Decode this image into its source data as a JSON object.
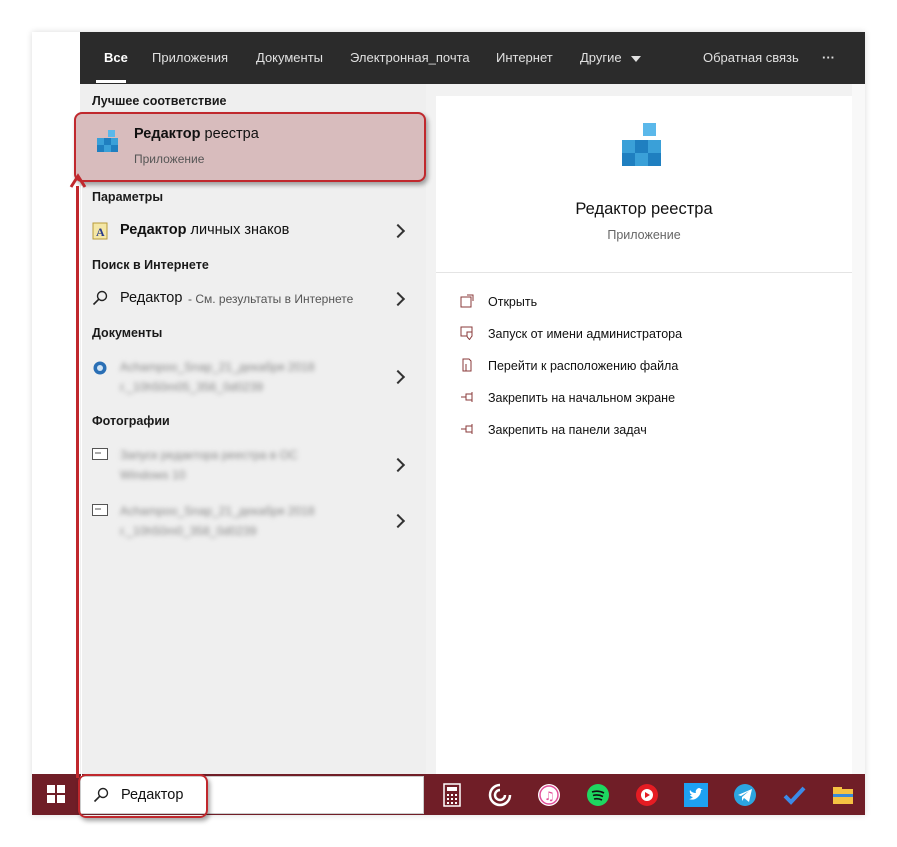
{
  "tabs": [
    {
      "label": "Все",
      "active": true
    },
    {
      "label": "Приложения"
    },
    {
      "label": "Документы"
    },
    {
      "label": "Электронная_почта"
    },
    {
      "label": "Интернет"
    },
    {
      "label": "Другие"
    }
  ],
  "feedback_label": "Обратная связь",
  "more_label": "···",
  "best_match": {
    "section": "Лучшее соответствие",
    "title_bold": "Редактор",
    "title_rest": " реестра",
    "subtitle": "Приложение"
  },
  "settings": {
    "section": "Параметры",
    "item_bold": "Редактор",
    "item_rest": " личных знаков"
  },
  "web": {
    "section": "Поиск в Интернете",
    "item": "Редактор",
    "item_sub": " - См. результаты в Интернете"
  },
  "documents": {
    "section": "Документы",
    "items": [
      {
        "line1": "Achampoo_Snap_21_декабря 2018",
        "line2": "г._10h50m05_356_0d0239"
      }
    ]
  },
  "photos": {
    "section": "Фотографии",
    "items": [
      {
        "line1": "Запуск редактора реестра в ОС",
        "line2": "Windows 10"
      },
      {
        "line1": "Achampoo_Snap_21_декабря 2018",
        "line2": "г._10h50m0_358_0d0239"
      }
    ]
  },
  "preview": {
    "title": "Редактор реестра",
    "subtitle": "Приложение",
    "actions": [
      {
        "label": "Открыть",
        "icon": "open-icon"
      },
      {
        "label": "Запуск от имени администратора",
        "icon": "shield-icon"
      },
      {
        "label": "Перейти к расположению файла",
        "icon": "file-icon"
      },
      {
        "label": "Закрепить на начальном экране",
        "icon": "pin-icon"
      },
      {
        "label": "Закрепить на панели задач",
        "icon": "pin-icon"
      }
    ]
  },
  "search": {
    "value": "Редактор"
  },
  "taskbar_icons": [
    "calculator-icon",
    "cortana-icon",
    "itunes-icon",
    "spotify-icon",
    "youtube-icon",
    "twitter-icon",
    "telegram-icon",
    "todo-icon",
    "explorer-icon"
  ],
  "colors": {
    "accent": "#c0282d",
    "taskbar": "#701e27",
    "nav": "#2b2b2b"
  }
}
